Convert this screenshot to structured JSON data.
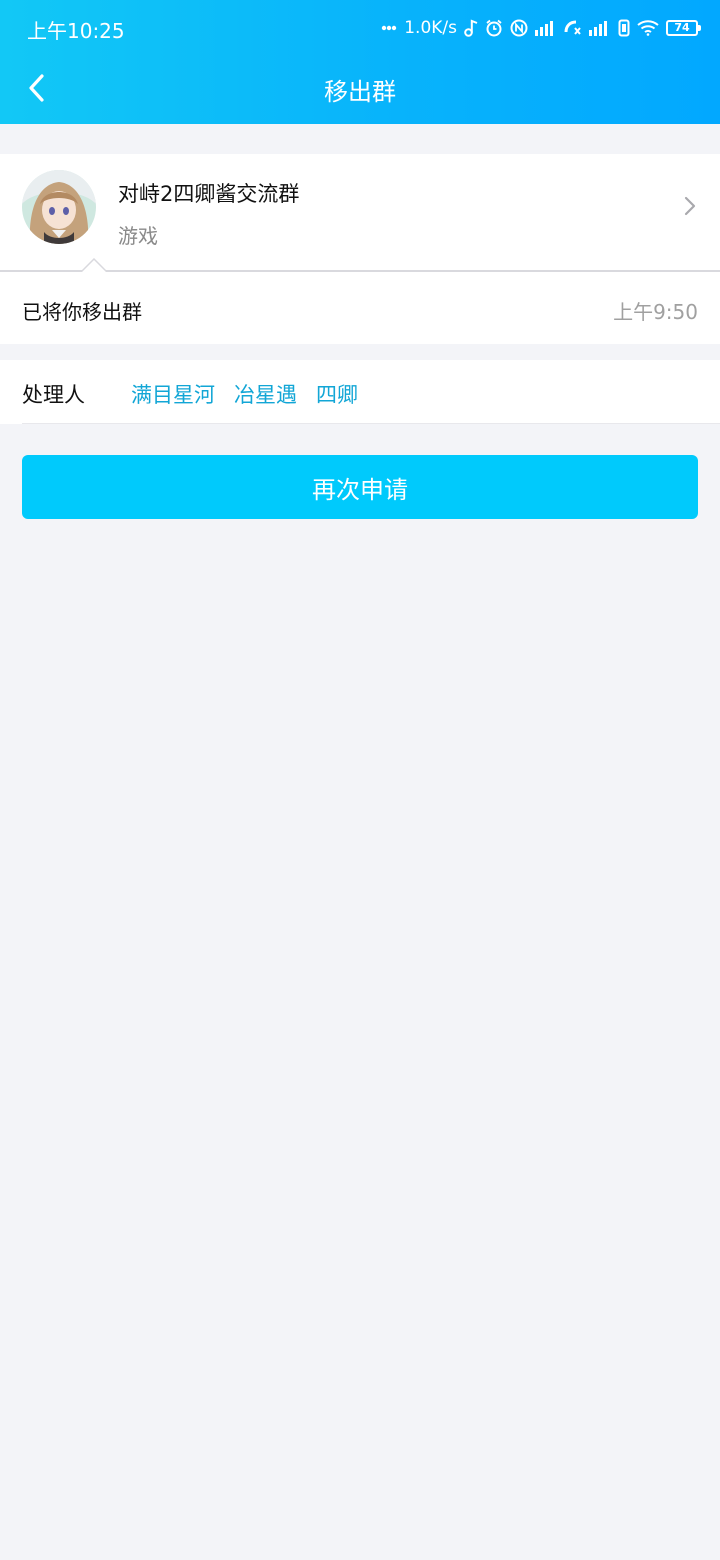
{
  "status_bar": {
    "time": "上午10:25",
    "network_speed": "1.0K/s",
    "battery": "74"
  },
  "nav": {
    "title": "移出群",
    "back_icon": "chevron-left-icon"
  },
  "group": {
    "name": "对峙2四卿酱交流群",
    "category": "游戏"
  },
  "message": {
    "text": "已将你移出群",
    "time": "上午9:50"
  },
  "handler": {
    "label": "处理人",
    "names": [
      "满目星河",
      "冶星遇",
      "四卿"
    ]
  },
  "action": {
    "apply_again_label": "再次申请"
  },
  "colors": {
    "header_start": "#12c8f6",
    "header_end": "#02a8ff",
    "button": "#00cafc",
    "link": "#12a6d6",
    "background": "#f3f4f8"
  }
}
